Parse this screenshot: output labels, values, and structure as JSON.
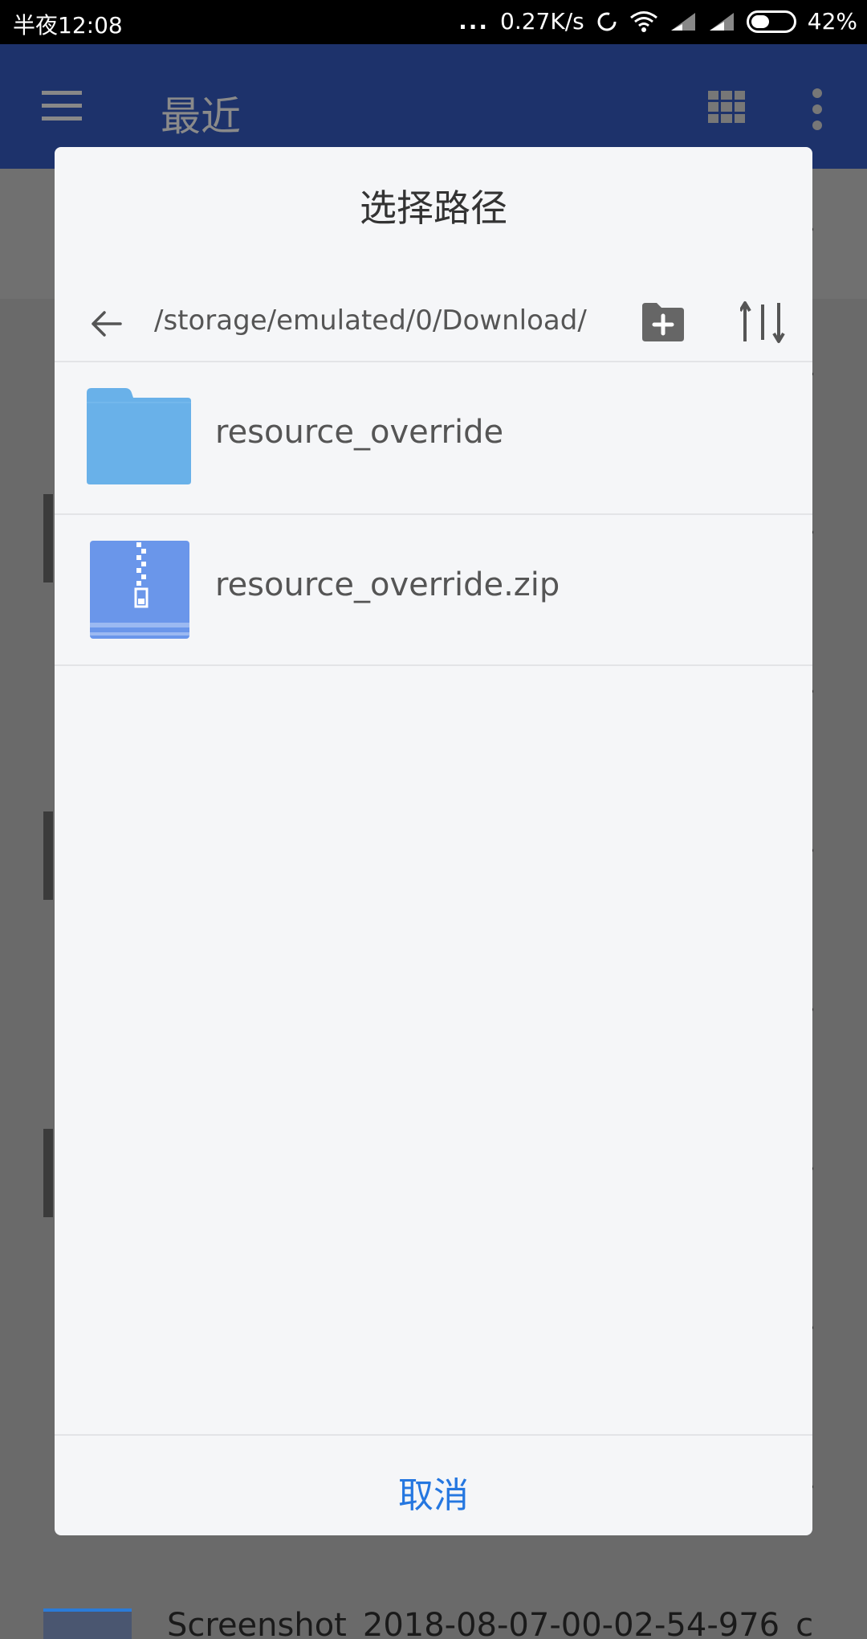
{
  "status_bar": {
    "time": "半夜12:08",
    "dots": "...",
    "net_speed": "0.27K/s",
    "battery": "42%"
  },
  "app_bar": {
    "title": "最近"
  },
  "background": {
    "last_item_name": "Screenshot_2018-08-07-00-02-54-976_c"
  },
  "dialog": {
    "title": "选择路径",
    "path": "/storage/emulated/0/Download/",
    "items": [
      {
        "name": "resource_override",
        "type": "folder"
      },
      {
        "name": "resource_override.zip",
        "type": "zip"
      }
    ],
    "cancel_label": "取消"
  },
  "colors": {
    "app_bar": "#1d326b",
    "folder_icon": "#69b1e9",
    "zip_icon": "#6a96ea",
    "accent": "#2577e0"
  }
}
